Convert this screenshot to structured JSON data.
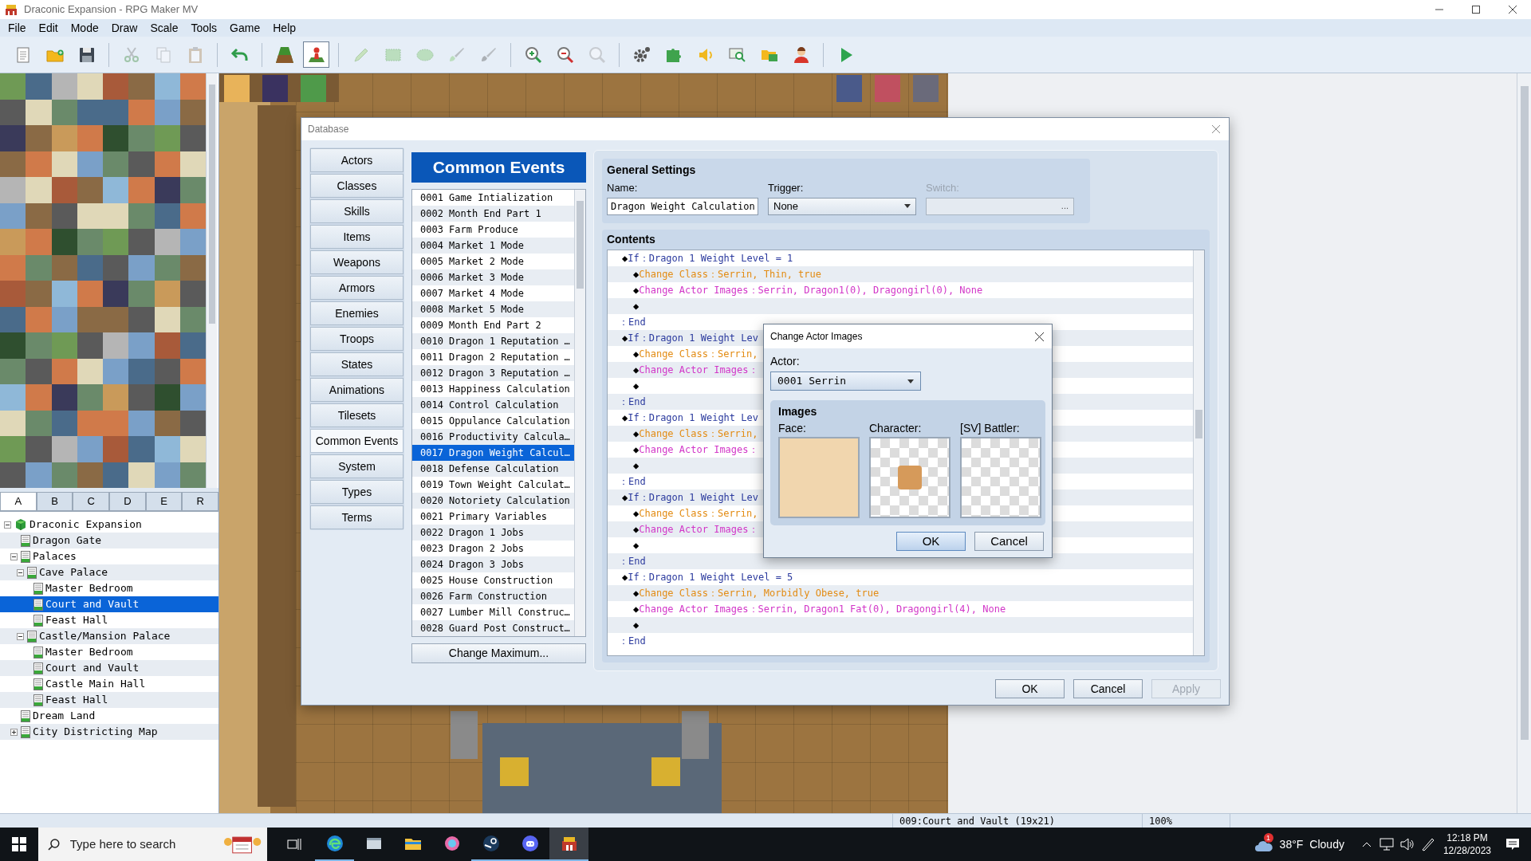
{
  "window": {
    "title": "Draconic Expansion - RPG Maker MV"
  },
  "menu": [
    "File",
    "Edit",
    "Mode",
    "Draw",
    "Scale",
    "Tools",
    "Game",
    "Help"
  ],
  "toolbar": [
    {
      "selected": false,
      "disabled": false
    },
    {
      "selected": false,
      "disabled": false
    },
    {
      "selected": false,
      "disabled": false
    },
    {
      "selected": false,
      "disabled": true
    },
    {
      "selected": false,
      "disabled": true
    },
    {
      "selected": false,
      "disabled": true
    },
    {
      "selected": false,
      "disabled": false
    },
    {
      "selected": false,
      "disabled": false
    },
    {
      "selected": true,
      "disabled": false
    },
    {
      "selected": false,
      "disabled": true
    },
    {
      "selected": false,
      "disabled": true
    },
    {
      "selected": false,
      "disabled": true
    },
    {
      "selected": false,
      "disabled": true
    },
    {
      "selected": false,
      "disabled": true
    },
    {
      "selected": false,
      "disabled": false
    },
    {
      "selected": false,
      "disabled": false
    },
    {
      "selected": false,
      "disabled": true
    },
    {
      "selected": false,
      "disabled": false
    },
    {
      "selected": false,
      "disabled": false
    },
    {
      "selected": false,
      "disabled": false
    },
    {
      "selected": false,
      "disabled": false
    },
    {
      "selected": false,
      "disabled": false
    },
    {
      "selected": false,
      "disabled": false
    },
    {
      "selected": false,
      "disabled": false
    }
  ],
  "tileset_tabs": [
    {
      "label": "A",
      "selected": true
    },
    {
      "label": "B",
      "selected": false
    },
    {
      "label": "C",
      "selected": false
    },
    {
      "label": "D",
      "selected": false
    },
    {
      "label": "E",
      "selected": false
    },
    {
      "label": "R",
      "selected": false
    }
  ],
  "map_tree": [
    {
      "label": "Draconic Expansion",
      "kind": "project",
      "expanded": true,
      "selected": false,
      "children": [
        {
          "label": "Dragon Gate",
          "kind": "map",
          "selected": false
        },
        {
          "label": "Palaces",
          "kind": "map",
          "expanded": true,
          "selected": false,
          "children": [
            {
              "label": "Cave Palace",
              "kind": "map",
              "expanded": true,
              "selected": false,
              "children": [
                {
                  "label": "Master Bedroom",
                  "kind": "map",
                  "selected": false
                },
                {
                  "label": "Court and Vault",
                  "kind": "map",
                  "selected": true
                },
                {
                  "label": "Feast Hall",
                  "kind": "map",
                  "selected": false
                }
              ]
            },
            {
              "label": "Castle/Mansion Palace",
              "kind": "map",
              "expanded": true,
              "selected": false,
              "children": [
                {
                  "label": "Master Bedroom",
                  "kind": "map",
                  "selected": false
                },
                {
                  "label": "Court and Vault",
                  "kind": "map",
                  "selected": false
                },
                {
                  "label": "Castle Main Hall",
                  "kind": "map",
                  "selected": false
                },
                {
                  "label": "Feast Hall",
                  "kind": "map",
                  "selected": false
                }
              ]
            }
          ]
        },
        {
          "label": "Dream Land",
          "kind": "map",
          "selected": false
        },
        {
          "label": "City Districting Map",
          "kind": "map",
          "expanded": false,
          "selected": false
        }
      ]
    }
  ],
  "status_bar": {
    "map": "009:Court and Vault (19x21)",
    "zoom": "100%"
  },
  "database": {
    "title": "Database",
    "categories": [
      {
        "label": "Actors",
        "selected": false
      },
      {
        "label": "Classes",
        "selected": false
      },
      {
        "label": "Skills",
        "selected": false
      },
      {
        "label": "Items",
        "selected": false
      },
      {
        "label": "Weapons",
        "selected": false
      },
      {
        "label": "Armors",
        "selected": false
      },
      {
        "label": "Enemies",
        "selected": false
      },
      {
        "label": "Troops",
        "selected": false
      },
      {
        "label": "States",
        "selected": false
      },
      {
        "label": "Animations",
        "selected": false
      },
      {
        "label": "Tilesets",
        "selected": false
      },
      {
        "label": "Common Events",
        "selected": true
      },
      {
        "label": "System",
        "selected": false
      },
      {
        "label": "Types",
        "selected": false
      },
      {
        "label": "Terms",
        "selected": false
      }
    ],
    "header": "Common Events",
    "events": [
      {
        "label": "0001 Game Intialization",
        "selected": false
      },
      {
        "label": "0002 Month End Part 1",
        "selected": false
      },
      {
        "label": "0003 Farm Produce",
        "selected": false
      },
      {
        "label": "0004 Market 1 Mode",
        "selected": false
      },
      {
        "label": "0005 Market 2 Mode",
        "selected": false
      },
      {
        "label": "0006 Market 3 Mode",
        "selected": false
      },
      {
        "label": "0007 Market 4 Mode",
        "selected": false
      },
      {
        "label": "0008 Market 5 Mode",
        "selected": false
      },
      {
        "label": "0009 Month End Part 2",
        "selected": false
      },
      {
        "label": "0010 Dragon 1 Reputation …",
        "selected": false
      },
      {
        "label": "0011 Dragon 2 Reputation …",
        "selected": false
      },
      {
        "label": "0012 Dragon 3 Reputation …",
        "selected": false
      },
      {
        "label": "0013 Happiness Calculation",
        "selected": false
      },
      {
        "label": "0014 Control Calculation",
        "selected": false
      },
      {
        "label": "0015 Oppulance Calculation",
        "selected": false
      },
      {
        "label": "0016 Productivity Calcula…",
        "selected": false
      },
      {
        "label": "0017 Dragon Weight Calcul…",
        "selected": true
      },
      {
        "label": "0018 Defense Calculation",
        "selected": false
      },
      {
        "label": "0019 Town Weight Calculat…",
        "selected": false
      },
      {
        "label": "0020 Notoriety Calculation",
        "selected": false
      },
      {
        "label": "0021 Primary Variables",
        "selected": false
      },
      {
        "label": "0022 Dragon 1 Jobs",
        "selected": false
      },
      {
        "label": "0023 Dragon 2 Jobs",
        "selected": false
      },
      {
        "label": "0024 Dragon 3 Jobs",
        "selected": false
      },
      {
        "label": "0025 House Construction",
        "selected": false
      },
      {
        "label": "0026 Farm Construction",
        "selected": false
      },
      {
        "label": "0027 Lumber Mill Construc…",
        "selected": false
      },
      {
        "label": "0028 Guard Post Construct…",
        "selected": false
      }
    ],
    "change_maximum": "Change Maximum...",
    "general_settings": {
      "title": "General Settings",
      "name_label": "Name:",
      "name": "Dragon Weight Calculation",
      "trigger_label": "Trigger:",
      "trigger": "None",
      "switch_label": "Switch:",
      "switch_disabled": true,
      "switch_button": "..."
    },
    "contents_title": "Contents",
    "contents": [
      {
        "kind": "if",
        "marker": "◆",
        "text": "If：Dragon 1 Weight Level = 1",
        "children": [
          {
            "kind": "class",
            "marker": "◆",
            "text": "Change Class：Serrin, Thin, true"
          },
          {
            "kind": "images",
            "marker": "◆",
            "text": "Change Actor Images：Serrin, Dragon1(0), Dragongirl(0), None"
          },
          {
            "kind": "blank",
            "marker": "◆"
          }
        ]
      },
      {
        "kind": "end",
        "text": "：End"
      },
      {
        "kind": "if",
        "marker": "◆",
        "text": "If：Dragon 1 Weight Lev",
        "children": [
          {
            "kind": "class",
            "marker": "◆",
            "text": "Change Class：Serrin,"
          },
          {
            "kind": "images",
            "marker": "◆",
            "text": "Change Actor Images："
          },
          {
            "kind": "blank",
            "marker": "◆"
          }
        ]
      },
      {
        "kind": "end",
        "text": "：End"
      },
      {
        "kind": "if",
        "marker": "◆",
        "text": "If：Dragon 1 Weight Lev",
        "children": [
          {
            "kind": "class",
            "marker": "◆",
            "text": "Change Class：Serrin,"
          },
          {
            "kind": "images",
            "marker": "◆",
            "text": "Change Actor Images："
          },
          {
            "kind": "blank",
            "marker": "◆"
          }
        ]
      },
      {
        "kind": "end",
        "text": "：End"
      },
      {
        "kind": "if",
        "marker": "◆",
        "text": "If：Dragon 1 Weight Lev",
        "children": [
          {
            "kind": "class",
            "marker": "◆",
            "text": "Change Class：Serrin,"
          },
          {
            "kind": "images",
            "marker": "◆",
            "text": "Change Actor Images："
          },
          {
            "kind": "blank",
            "marker": "◆"
          }
        ]
      },
      {
        "kind": "end",
        "text": "：End"
      },
      {
        "kind": "if",
        "marker": "◆",
        "text": "If：Dragon 1 Weight Level = 5",
        "children": [
          {
            "kind": "class",
            "marker": "◆",
            "text": "Change Class：Serrin, Morbidly Obese, true"
          },
          {
            "kind": "images",
            "marker": "◆",
            "text": "Change Actor Images：Serrin, Dragon1 Fat(0), Dragongirl(4), None"
          },
          {
            "kind": "blank",
            "marker": "◆"
          }
        ]
      },
      {
        "kind": "end",
        "text": "：End"
      }
    ],
    "buttons": [
      {
        "label": "OK",
        "disabled": false
      },
      {
        "label": "Cancel",
        "disabled": false
      },
      {
        "label": "Apply",
        "disabled": true
      }
    ]
  },
  "dialog": {
    "title": "Change Actor Images",
    "actor_label": "Actor:",
    "actor": "0001 Serrin",
    "images_title": "Images",
    "slots": [
      {
        "label": "Face:",
        "kind": "face"
      },
      {
        "label": "Character:",
        "kind": "character"
      },
      {
        "label": "[SV] Battler:",
        "kind": "empty"
      }
    ],
    "buttons": [
      {
        "label": "OK",
        "default": true
      },
      {
        "label": "Cancel",
        "default": false
      }
    ]
  },
  "taskbar": {
    "search": {
      "placeholder": "Type here to search"
    },
    "apps": [
      {
        "running": true,
        "selected": false
      },
      {
        "running": false,
        "selected": false
      },
      {
        "running": false,
        "selected": false
      },
      {
        "running": false,
        "selected": false
      },
      {
        "running": true,
        "selected": false
      },
      {
        "running": true,
        "selected": false
      },
      {
        "running": true,
        "selected": true
      }
    ],
    "weather_badge": "1",
    "temperature": "38°F",
    "weather": "Cloudy",
    "time": "12:18 PM",
    "date": "12/28/2023"
  }
}
